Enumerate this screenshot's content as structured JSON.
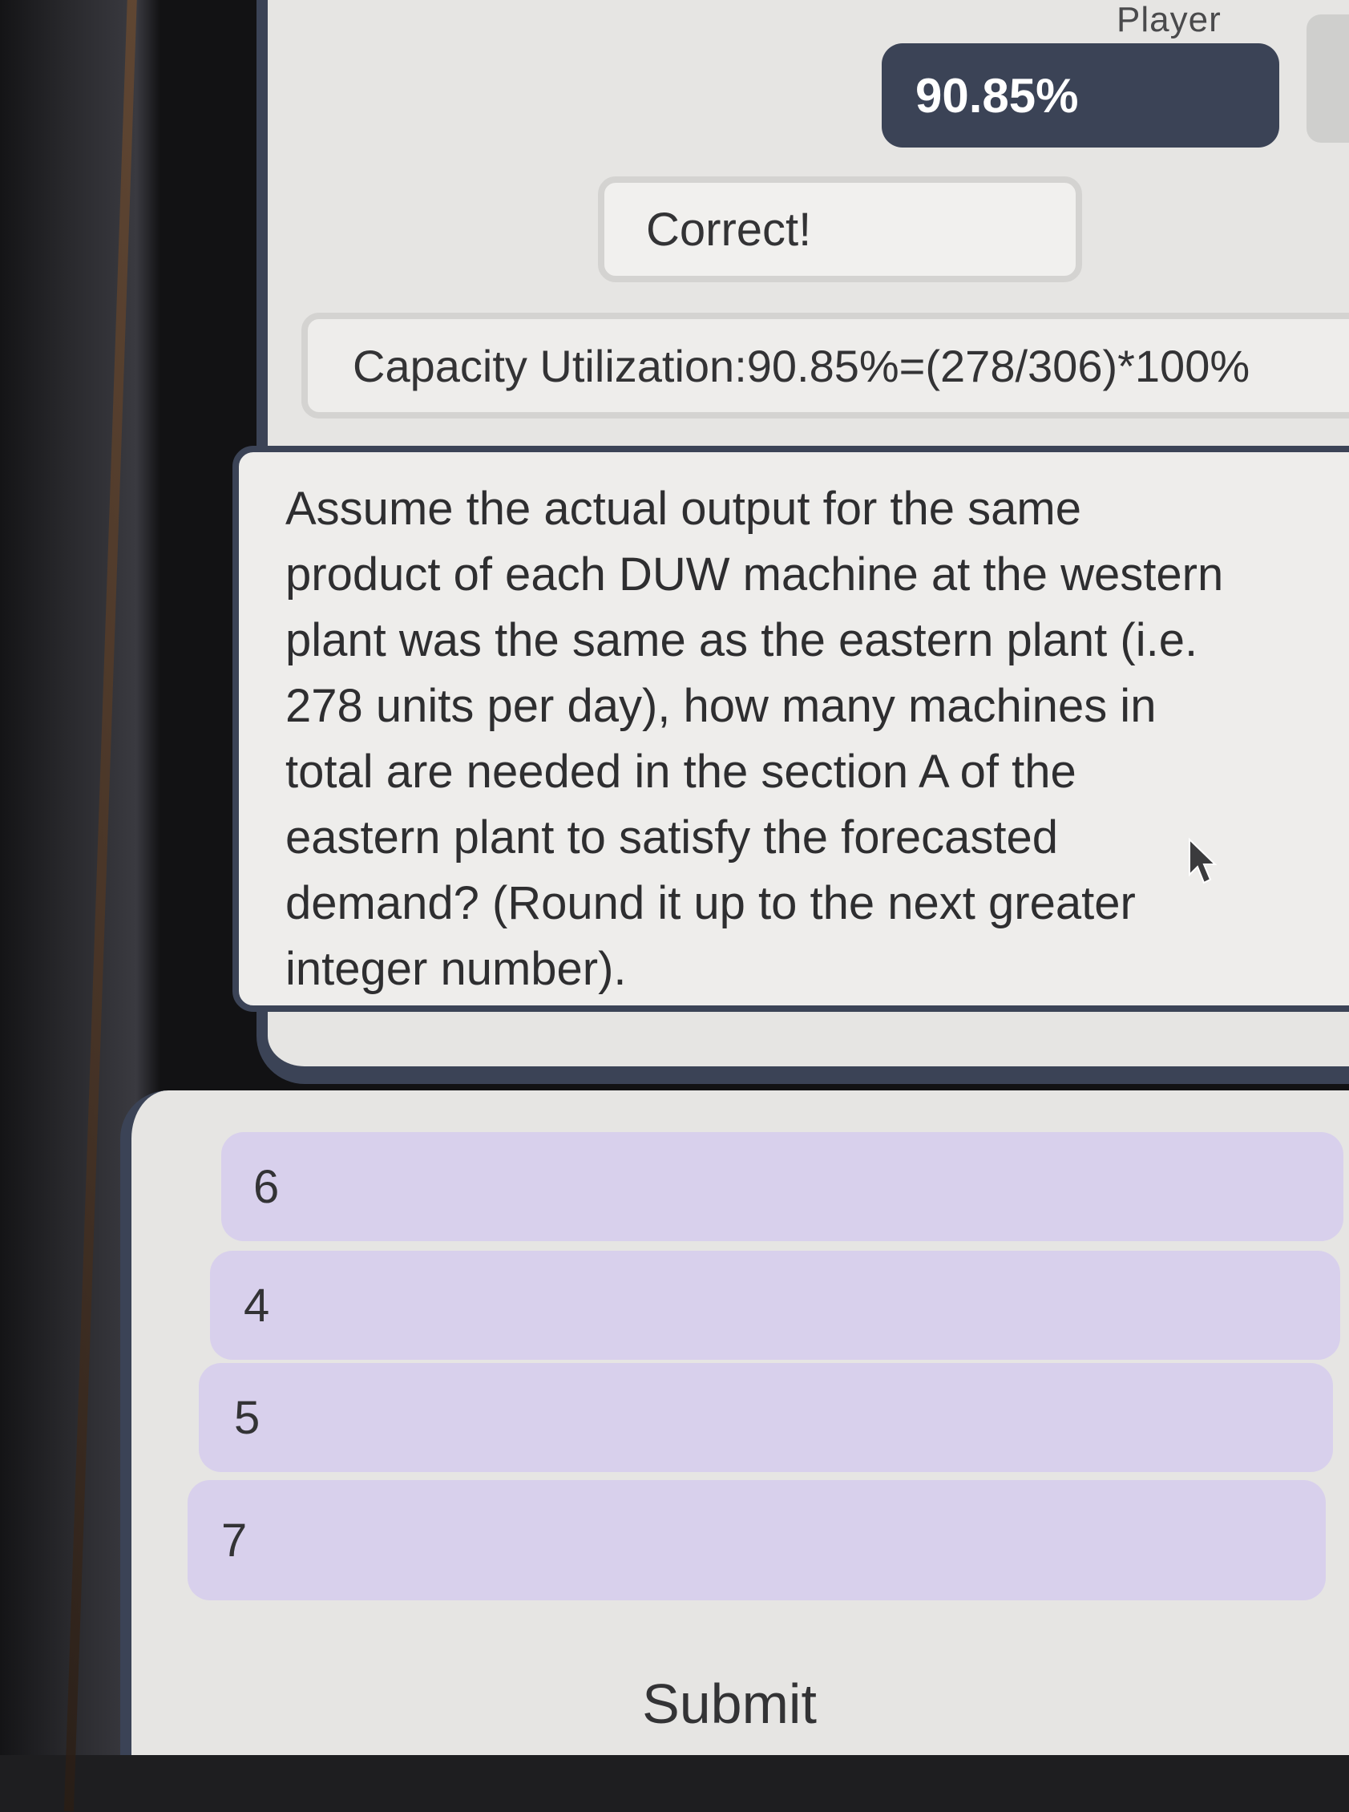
{
  "header": {
    "player_label": "Player",
    "score": "90.85%"
  },
  "feedback": {
    "result": "Correct!",
    "explanation": "Capacity Utilization:90.85%=(278/306)*100%"
  },
  "question": {
    "lines": [
      "Assume the actual output for the same",
      "product of each DUW machine at the western",
      "plant was the same as the eastern plant (i.e.",
      "278 units per day), how many machines in",
      "total are needed in the section A of the",
      "eastern plant to satisfy the forecasted",
      "demand? (Round it up to the next greater",
      "integer number)."
    ]
  },
  "answers": {
    "options": [
      "6",
      "4",
      "5",
      "7"
    ]
  },
  "actions": {
    "submit_label": "Submit"
  },
  "icons": {
    "cursor": "mouse-pointer-icon"
  },
  "colors": {
    "accent": "#3b4356",
    "option_bg": "#d8d0ec",
    "panel_bg": "#e6e5e3"
  }
}
